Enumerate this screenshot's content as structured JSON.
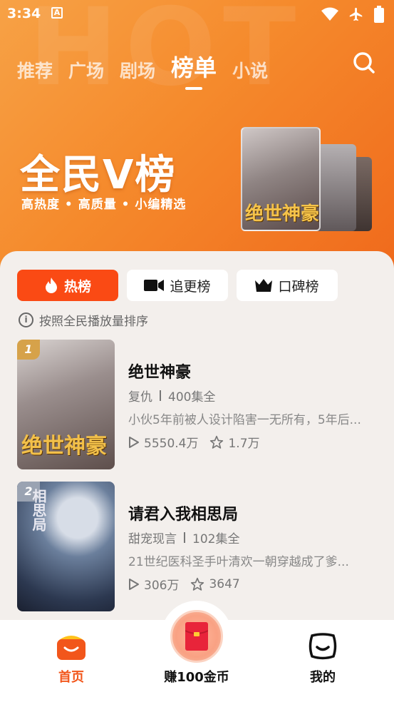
{
  "status": {
    "time": "3:34",
    "a_icon": "A"
  },
  "nav": {
    "tabs": [
      {
        "label": "推荐",
        "active": false
      },
      {
        "label": "广场",
        "active": false
      },
      {
        "label": "剧场",
        "active": false
      },
      {
        "label": "榜单",
        "active": true
      },
      {
        "label": "小说",
        "active": false
      }
    ],
    "search_icon": "search-icon"
  },
  "banner": {
    "title": "全民V榜",
    "subtitle": "高热度 • 高质量 • 小编精选",
    "cover_calligraphy": "绝世神豪"
  },
  "filters": [
    {
      "label": "热榜",
      "icon": "flame-icon",
      "active": true
    },
    {
      "label": "追更榜",
      "icon": "video-camera-icon",
      "active": false
    },
    {
      "label": "口碑榜",
      "icon": "crown-icon",
      "active": false
    }
  ],
  "sort_note": "按照全民播放量排序",
  "items": [
    {
      "rank": "1",
      "title": "绝世神豪",
      "genre": "复仇",
      "episodes": "400集全",
      "desc": "小伙5年前被人设计陷害一无所有，5年后...",
      "plays": "5550.4万",
      "stars": "1.7万",
      "poster_text": "绝世神豪"
    },
    {
      "rank": "2",
      "title": "请君入我相思局",
      "genre": "甜宠现言",
      "episodes": "102集全",
      "desc": "21世纪医科圣手叶清欢一朝穿越成了爹...",
      "plays": "306万",
      "stars": "3647",
      "poster_text": "相思局"
    }
  ],
  "bottom_nav": {
    "home": "首页",
    "earn": "赚100金币",
    "mine": "我的"
  },
  "colors": {
    "accent": "#fa4a14",
    "banner": "#f58a2c",
    "home_active": "#f2561b"
  }
}
